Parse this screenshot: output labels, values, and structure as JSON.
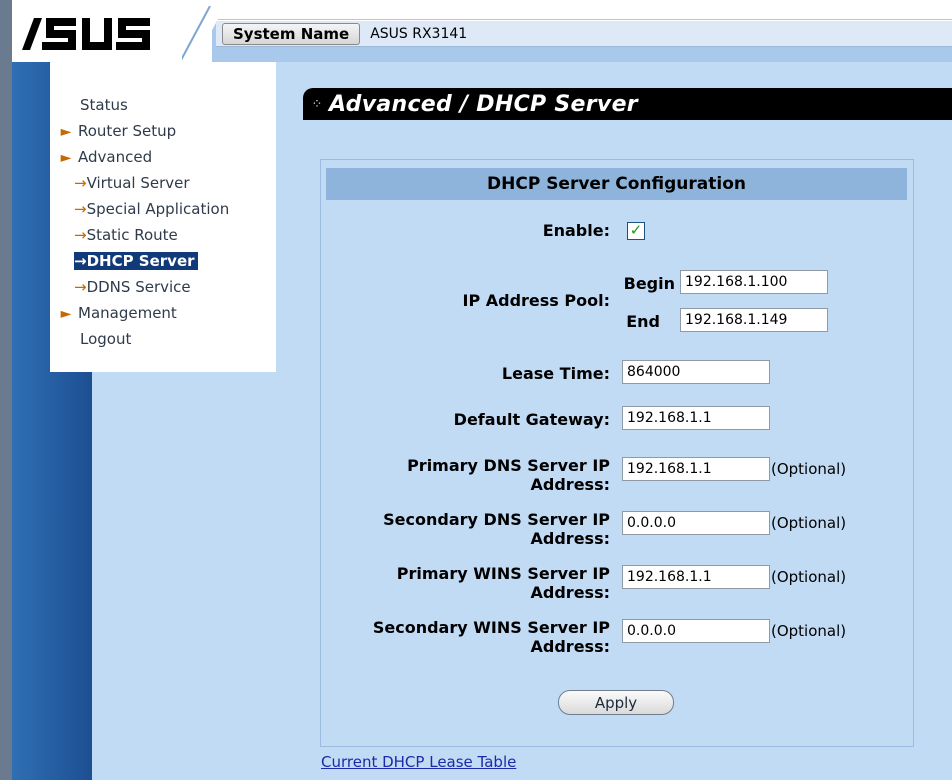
{
  "header": {
    "logo": "/ISUS",
    "system_name_label": "System Name",
    "system_name_value": "ASUS RX3141"
  },
  "nav": {
    "items": [
      {
        "label": "Status",
        "type": "top"
      },
      {
        "label": "Router Setup",
        "type": "section"
      },
      {
        "label": "Advanced",
        "type": "section"
      },
      {
        "label": "Virtual Server",
        "type": "sub"
      },
      {
        "label": "Special Application",
        "type": "sub"
      },
      {
        "label": "Static Route",
        "type": "sub"
      },
      {
        "label": "DHCP Server",
        "type": "sub",
        "active": true
      },
      {
        "label": "DDNS Service",
        "type": "sub"
      },
      {
        "label": "Management",
        "type": "section"
      },
      {
        "label": "Logout",
        "type": "top"
      }
    ]
  },
  "page": {
    "title": "Advanced / DHCP Server"
  },
  "form": {
    "heading": "DHCP Server Configuration",
    "enable_label": "Enable:",
    "enable_checked": true,
    "ip_pool_label": "IP Address Pool:",
    "begin_label": "Begin",
    "begin_value": "192.168.1.100",
    "end_label": "End",
    "end_value": "192.168.1.149",
    "lease_label": "Lease Time:",
    "lease_value": "864000",
    "gateway_label": "Default Gateway:",
    "gateway_value": "192.168.1.1",
    "pdns_label_1": "Primary DNS Server IP",
    "pdns_label_2": "Address:",
    "pdns_value": "192.168.1.1",
    "sdns_label_1": "Secondary DNS Server IP",
    "sdns_label_2": "Address:",
    "sdns_value": "0.0.0.0",
    "pwins_label_1": "Primary WINS Server IP",
    "pwins_label_2": "Address:",
    "pwins_value": "192.168.1.1",
    "swins_label_1": "Secondary WINS Server IP",
    "swins_label_2": "Address:",
    "swins_value": "0.0.0.0",
    "optional": "(Optional)",
    "apply_label": "Apply"
  },
  "footer": {
    "lease_table_link": "Current DHCP Lease Table"
  },
  "icons": {
    "section_arrow": "triangle-right-icon",
    "sub_arrow": "arrow-right-icon",
    "check": "checkmark-icon",
    "title_bullet": "bullet-icon"
  },
  "colors": {
    "background": "#c2dbf5",
    "nav_active_bg": "#113a78",
    "title_bg": "#000000",
    "panel_header": "#8fb4dc",
    "link": "#1b2aa8"
  }
}
